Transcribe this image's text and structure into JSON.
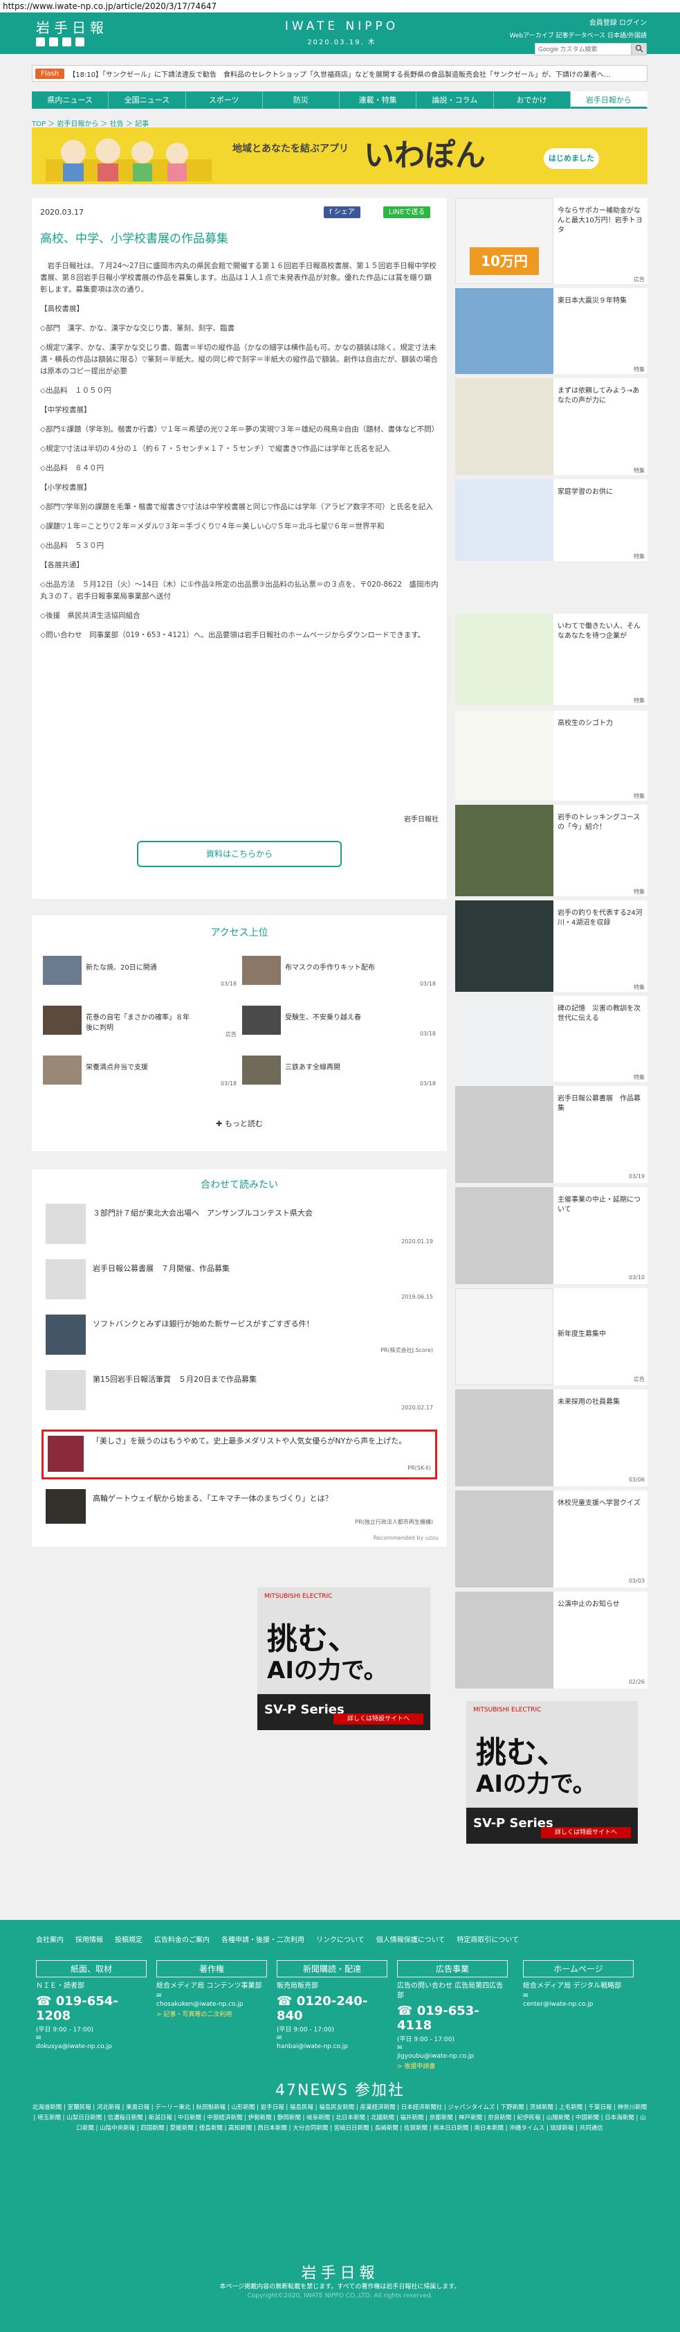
{
  "url": "https://www.iwate-np.co.jp/article/2020/3/17/74647",
  "header": {
    "logo": "岩手日報",
    "brand_en": "IWATE NIPPO",
    "date": "2020.03.19. 木",
    "links1": "会員登録  ログイン",
    "links2": "Webアーカイブ  記事データベース  日本語/外国語",
    "search_placeholder": "Google カスタム検索"
  },
  "flash": {
    "tag": "Flash",
    "text": "【18:10】「サンクゼール」に下請法違反で勧告　食料品のセレクトショップ「久世福商店」などを展開する長野県の食品製造販売会社「サンクゼール」が、下請けの業者へ…"
  },
  "nav": [
    "県内ニュース",
    "全国ニュース",
    "スポーツ",
    "防災",
    "連載・特集",
    "論説・コラム",
    "おでかけ",
    "岩手日報から"
  ],
  "breadcrumb": "TOP ＞ 岩手日報から ＞ 社告 ＞ 記事",
  "banner": {
    "title": "地域とあなたを結ぶアプリ",
    "big": "いわぽん",
    "chip": "はじめました"
  },
  "article": {
    "date": "2020.03.17",
    "share_fb": "シェア",
    "share_line": "LINEで送る",
    "title": "高校、中学、小学校書展の作品募集",
    "paragraphs": [
      "　岩手日報社は、７月24～27日に盛岡市内丸の県民会館で開催する第１６回岩手日報高校書展、第１５回岩手日報中学校書展、第８回岩手日報小学校書展の作品を募集します。出品は１人１点で未発表作品が対象。優れた作品には賞を贈り顕彰します。募集要項は次の通り。",
      "【高校書展】",
      "◇部門　漢字、かな、漢字かな交じり書、篆刻、刻字、臨書",
      "◇規定▽漢字、かな、漢字かな交じり書、臨書＝半切の縦作品（かなの細字は横作品も可。かなの額装は除く。規定寸法未満・横長の作品は額装に限る）▽篆刻＝半紙大。縦の同じ枠で刻字＝半紙大の縦作品で額装。創作は自由だが、額装の場合は原本のコピー提出が必要",
      "◇出品料　１０５０円",
      "【中学校書展】",
      "◇部門①課題（学年別。楷書か行書）▽１年＝希望の光▽２年＝夢の実現▽３年＝雄紀の飛鳥②自由（題材、書体など不問）",
      "◇規定▽寸法は半切の４分の１（約６７・５センチ×１７・５センチ）で縦書き▽作品には学年と氏名を記入",
      "◇出品料　８４０円",
      "【小学校書展】",
      "◇部門▽学年別の課題を毛筆・楷書で縦書き▽寸法は中学校書展と同じ▽作品には学年（アラビア数字不可）と氏名を記入",
      "◇課題▽１年＝ことり▽２年＝メダル▽３年＝手づくり▽４年＝美しい心▽５年＝北斗七星▽６年＝世界平和",
      "◇出品料　５３０円",
      "【各展共通】",
      "◇出品方法　５月12日（火）～14日（木）に①作品②所定の出品票③出品料の払込票＝の３点を、〒020-8622　盛岡市内丸３の７、岩手日報事業局事業部へ送付",
      "◇後援　県民共済生活協同組合",
      "◇問い合わせ　同事業部（019・653・4121）へ。出品要領は岩手日報社のホームページからダウンロードできます。"
    ],
    "source": "岩手日報社",
    "pdf_button": "資料はこちらから"
  },
  "access": {
    "title": "アクセス上位",
    "items": [
      {
        "title": "新たな焼、20日に開通",
        "date": "03/18"
      },
      {
        "title": "布マスクの手作りキット配布",
        "date": "03/18"
      },
      {
        "title": "花巻の自宅「まさかの確率」８年後に判明",
        "date": "広告"
      },
      {
        "title": "受験生、不安乗り越え春",
        "date": "03/18"
      },
      {
        "title": "栄養満点弁当で支援",
        "date": "03/18"
      },
      {
        "title": "三鉄あす全線再開",
        "date": "03/18"
      }
    ],
    "more": "もっと読む"
  },
  "recommend": {
    "title": "合わせて読みたい",
    "items": [
      {
        "title": "３部門計７組が東北大会出場へ　アンサンブルコンテスト県大会",
        "meta": "2020.01.19"
      },
      {
        "title": "岩手日報公募書展　７月開催、作品募集",
        "meta": "2019.06.15"
      },
      {
        "title": "ソフトバンクとみずほ銀行が始めた新サービスがすごすぎる件！",
        "meta": "PR(株式会社J.Score)"
      },
      {
        "title": "第15回岩手日報活筆賞　５月20日まで作品募集",
        "meta": "2020.02.17"
      },
      {
        "title": "「美しさ」を競うのはもうやめて。史上最多メダリストや人気女優らがNYから声を上げた。",
        "meta": "PR(SK-II)"
      },
      {
        "title": "高輪ゲートウェイ駅から始まる、「エキマチ一体のまちづくり」とは？",
        "meta": "PR(独立行政法人都市再生機構)"
      }
    ],
    "powered": "Recommended by uzou"
  },
  "ad_left": {
    "brand": "MITSUBISHI ELECTRIC",
    "headline1": "挑む、",
    "headline2": "AIの力で。",
    "product": "SV-P Series",
    "cta": "詳しくは特設サイトへ"
  },
  "sidebar": [
    {
      "title": "今ならサポカー補助金がなんと最大10万円！岩手トヨタ",
      "label": "広告"
    },
    {
      "title": "東日本大震災９年特集",
      "label": "特集"
    },
    {
      "title": "まずは依頼してみよう→あなたの声が力に",
      "label": "特集"
    },
    {
      "title": "家庭学習のお供に",
      "label": "特集"
    },
    {
      "title": "いわてで働きたい人、そんなあなたを待つ企業が",
      "label": "特集"
    },
    {
      "title": "高校生のシゴト力",
      "label": "特集"
    },
    {
      "title": "岩手のトレッキングコースの「今」紹介！",
      "label": "特集"
    },
    {
      "title": "岩手の釣りを代表する24河川・4湖沼を収録",
      "label": "特集"
    },
    {
      "title": "碑の記憶　災害の教訓を次世代に伝える",
      "label": "特集"
    },
    {
      "title": "岩手日報公募書展　作品募集",
      "label": "03/19"
    },
    {
      "title": "主催事業の中止・延期について",
      "label": "03/10"
    },
    {
      "title": "新年度生募集中",
      "label": "広告"
    },
    {
      "title": "未来探用の社員募集",
      "label": "03/06"
    },
    {
      "title": "休校児童支援へ学習クイズ",
      "label": "03/03"
    },
    {
      "title": "公演中止のお知らせ",
      "label": "02/26"
    }
  ],
  "footer": {
    "links": [
      "会社案内",
      "採用情報",
      "投稿規定",
      "広告料金のご案内",
      "各種申請・後援・二次利用",
      "リンクについて",
      "個人情報保護について",
      "特定商取引について"
    ],
    "cols": [
      {
        "head": "紙面、取材",
        "sub": "ＮＩＥ・読者部",
        "tel": "019-654-1208",
        "small": "(平日 9:00 - 17:00)",
        "mail": "dokusya@iwate-np.co.jp"
      },
      {
        "head": "著作権",
        "sub": "総合メディア局 コンテンツ事業部",
        "tel": "",
        "small": "",
        "mail": "chosakuken@iwate-np.co.jp",
        "extra": "> 記事・写真等の二次利用"
      },
      {
        "head": "新聞購読・配達",
        "sub": "販売局販売部",
        "tel": "0120-240-840",
        "small": "(平日 9:00 - 17:00)",
        "mail": "hanbai@iwate-np.co.jp"
      },
      {
        "head": "広告事業",
        "sub": "広告の問い合わせ 広告局第四広告部",
        "tel": "019-653-4118",
        "small": "(平日 9:00 - 17:00)",
        "mail": "jigyoubu@iwate-np.co.jp",
        "extra": "> 後援申請書"
      },
      {
        "head": "ホームページ",
        "sub": "総合メディア局 デジタル戦略部",
        "tel": "",
        "small": "",
        "mail": "center@iwate-np.co.jp"
      }
    ],
    "n47_title": "47NEWS 参加社",
    "n47_list": "北海道新聞 | 室蘭民報 | 河北新報 | 東奥日報 | デーリー東北 | 秋田魁新報 | 山形新聞 | 岩手日報 | 福島民報 | 福島民友新聞 | 産業経済新聞 | 日本経済新聞社 | ジャパンタイムズ | 下野新聞 | 茨城新聞 | 上毛新聞 | 千葉日報 | 神奈川新聞 | 埼玉新聞 | 山梨日日新聞 | 信濃毎日新聞 | 新潟日報 | 中日新聞 | 中部経済新聞 | 伊勢新聞 | 静岡新聞 | 岐阜新聞 | 北日本新聞 | 北國新聞 | 福井新聞 | 京都新聞 | 神戸新聞 | 奈良新聞 | 紀伊民報 | 山陽新聞 | 中国新聞 | 日本海新聞 | 山口新聞 | 山陰中央新報 | 四国新聞 | 愛媛新聞 | 徳島新聞 | 高知新聞 | 西日本新聞 | 大分合同新聞 | 宮崎日日新聞 | 長崎新聞 | 佐賀新聞 | 熊本日日新聞 | 南日本新聞 | 沖縄タイムス | 琉球新報 | 共同通信",
    "logo": "岩手日報",
    "note": "本ページ掲載内容の無断転載を禁じます。すべての著作権は岩手日報社に帰属します。",
    "copy": "Copyright©2020, IWATE NIPPO CO.,LTD. All rights reserved."
  }
}
